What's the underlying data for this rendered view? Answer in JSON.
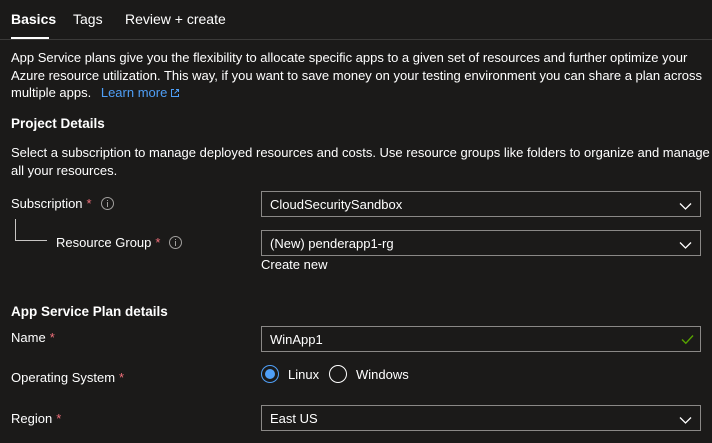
{
  "tabs": [
    {
      "label": "Basics",
      "active": true
    },
    {
      "label": "Tags",
      "active": false
    },
    {
      "label": "Review + create",
      "active": false
    }
  ],
  "intro": {
    "line1": "App Service plans give you the flexibility to allocate specific apps to a given set of resources and further optimize your",
    "line2": "Azure resource utilization. This way, if you want to save money on your testing environment you can share a plan across",
    "line3": "multiple apps.",
    "learn_more": "Learn more"
  },
  "project_details": {
    "heading": "Project Details",
    "desc_line1": "Select a subscription to manage deployed resources and costs. Use resource groups like folders to organize and manage",
    "desc_line2": "all your resources.",
    "subscription": {
      "label": "Subscription",
      "required": "*",
      "value": "CloudSecuritySandbox"
    },
    "resource_group": {
      "label": "Resource Group",
      "required": "*",
      "value": "(New) penderapp1-rg",
      "create_new": "Create new"
    }
  },
  "plan_details": {
    "heading": "App Service Plan details",
    "name": {
      "label": "Name",
      "required": "*",
      "value": "WinApp1",
      "valid": true
    },
    "os": {
      "label": "Operating System",
      "required": "*",
      "options": [
        "Linux",
        "Windows"
      ],
      "selected": "Linux"
    },
    "region": {
      "label": "Region",
      "required": "*",
      "value": "East US"
    }
  },
  "colors": {
    "background": "#1b1a19",
    "link": "#4f9ff7",
    "required": "#f1707b",
    "valid_check": "#57a300",
    "border": "#8a8886"
  },
  "icons": {
    "info": "info-icon",
    "dropdown": "chevron-down-icon",
    "external": "external-link-icon",
    "valid": "checkmark-icon"
  }
}
